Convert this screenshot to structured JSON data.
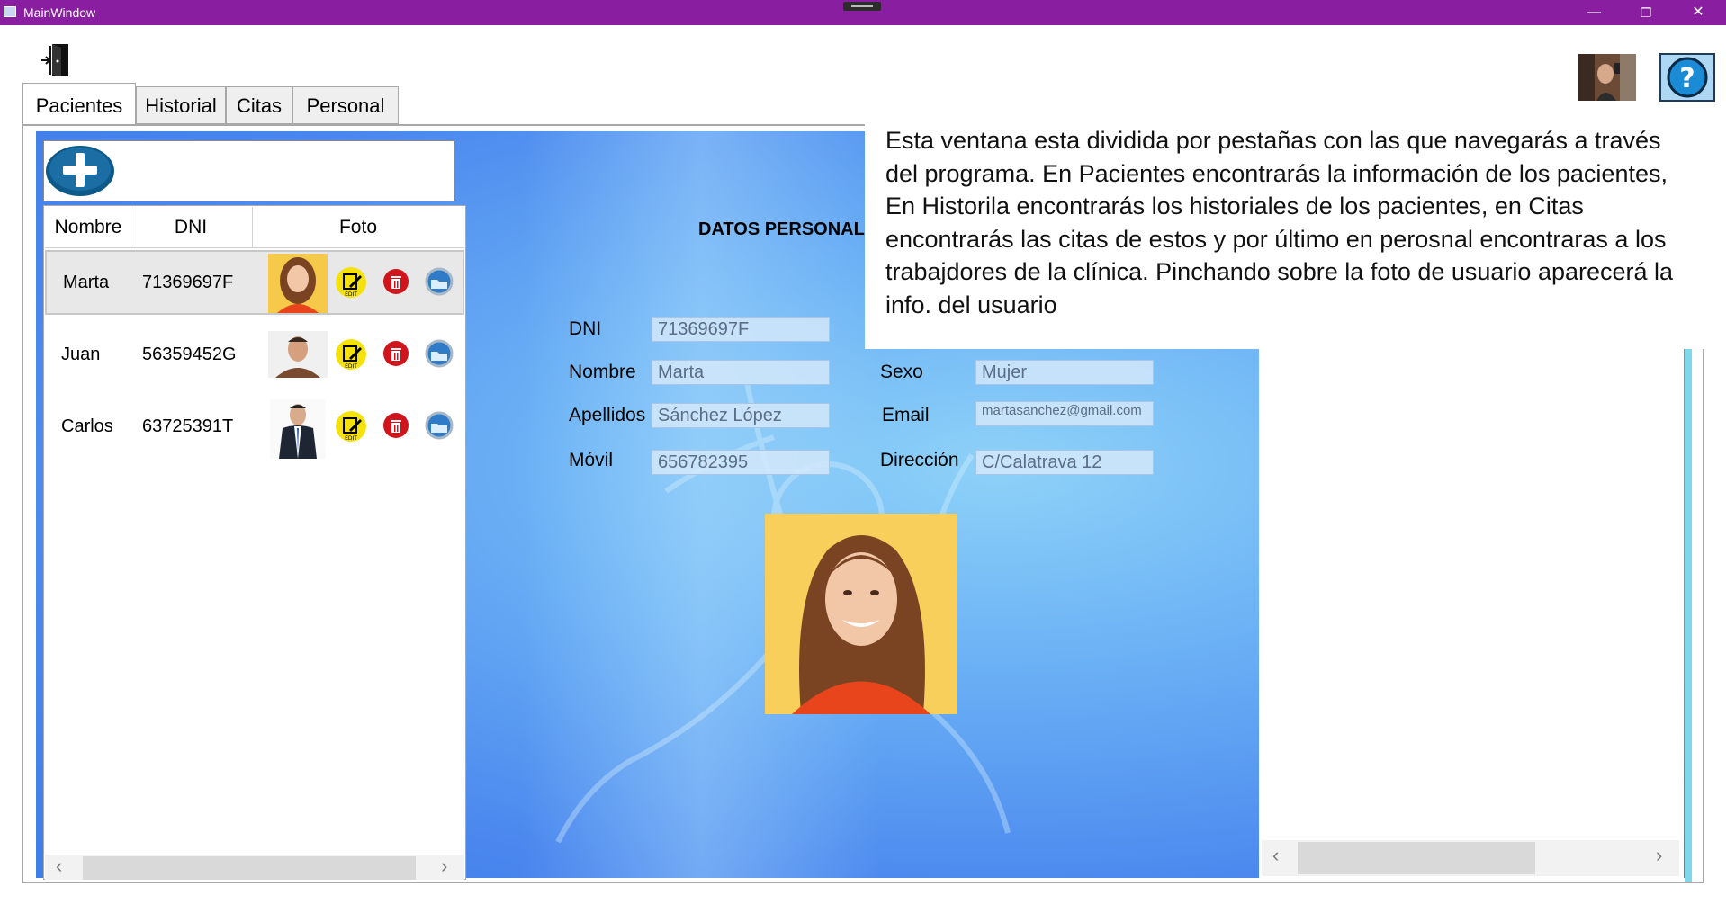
{
  "window": {
    "title": "MainWindow",
    "controls": {
      "minimize": "—",
      "maximize": "❐",
      "close": "✕"
    }
  },
  "toolbar": {
    "exit_icon": "exit-door-icon",
    "user_photo_icon": "user-avatar",
    "help_icon": "question-mark-icon"
  },
  "tabs": [
    {
      "label": "Pacientes",
      "active": true
    },
    {
      "label": "Historial",
      "active": false
    },
    {
      "label": "Citas",
      "active": false
    },
    {
      "label": "Personal",
      "active": false
    }
  ],
  "patients": {
    "add_icon": "plus-icon",
    "columns": [
      "Nombre",
      "DNI",
      "Foto"
    ],
    "rows": [
      {
        "name": "Marta",
        "dni": "71369697F",
        "selected": true
      },
      {
        "name": "Juan",
        "dni": "56359452G",
        "selected": false
      },
      {
        "name": "Carlos",
        "dni": "63725391T",
        "selected": false
      }
    ],
    "row_action_icons": [
      "edit-icon",
      "delete-icon",
      "view-icon"
    ],
    "edit_badge": "EDIT"
  },
  "details": {
    "section_title": "DATOS PERSONAL",
    "fields": {
      "dni": {
        "label": "DNI",
        "value": "71369697F"
      },
      "nombre": {
        "label": "Nombre",
        "value": "Marta"
      },
      "apellidos": {
        "label": "Apellidos",
        "value": "Sánchez López"
      },
      "movil": {
        "label": "Móvil",
        "value": "656782395"
      },
      "sexo": {
        "label": "Sexo",
        "value": "Mujer"
      },
      "email": {
        "label": "Email",
        "value": "martasanchez@gmail.com"
      },
      "direccion": {
        "label": "Dirección",
        "value": "C/Calatrava 12"
      }
    }
  },
  "scroll": {
    "left": "‹",
    "right": "›"
  },
  "help": {
    "text": "Esta ventana esta dividida por pestañas con las que navegarás a través del programa. En Pacientes encontrarás la información de los pacientes, En Historila encontrarás los historiales de los pacientes, en Citas encontrarás las citas de estos y por último en perosnal encontraras a los trabajdores de la clínica. Pinchando sobre la foto de usuario aparecerá la info. del usuario"
  },
  "colors": {
    "titlebar": "#8a1ea0",
    "background_blue": "#4a86ee",
    "field_bg": "#d2e8fa",
    "add_button": "#0d5a8a",
    "edit_yellow": "#f5e10c",
    "delete_red": "#d0141c"
  }
}
